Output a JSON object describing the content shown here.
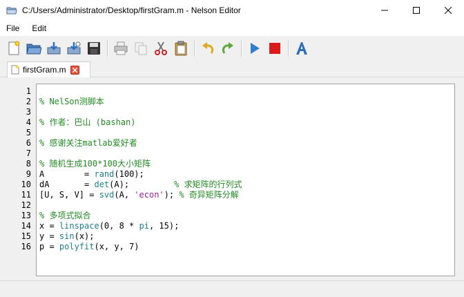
{
  "window": {
    "title": "C:/Users/Administrator/Desktop/firstGram.m - Nelson Editor"
  },
  "menu": [
    {
      "label": "File"
    },
    {
      "label": "Edit"
    }
  ],
  "toolbar": {
    "icons": [
      "new-file-icon",
      "open-folder-icon",
      "save-icon",
      "save-as-icon",
      "save-all-icon",
      "print-icon",
      "copy-icon",
      "cut-icon",
      "paste-icon",
      "undo-icon",
      "redo-icon",
      "run-icon",
      "stop-icon",
      "font-icon"
    ]
  },
  "tab": {
    "label": "firstGram.m"
  },
  "editor": {
    "line_numbers": [
      "1",
      "2",
      "3",
      "4",
      "5",
      "6",
      "7",
      "8",
      "9",
      "10",
      "11",
      "12",
      "13",
      "14",
      "15",
      "16"
    ],
    "lines": [
      "",
      "% NelSon测脚本",
      "",
      "% 作者：巴山 (bashan)",
      "",
      "% 感谢关注matlab爱好者",
      "",
      "% 随机生成100*100大小矩阵",
      "A        = rand(100);",
      "dA       = det(A);         % 求矩阵的行列式",
      "[U, S, V] = svd(A, 'econ'); % 奇异矩阵分解",
      "",
      "% 多项式拟合",
      "x = linspace(0, 8 * pi, 15);",
      "y = sin(x);",
      "p = polyfit(x, y, 7)"
    ]
  },
  "colors": {
    "comment": "#228b22",
    "function": "#1e7f8f",
    "string": "#a020a0"
  }
}
